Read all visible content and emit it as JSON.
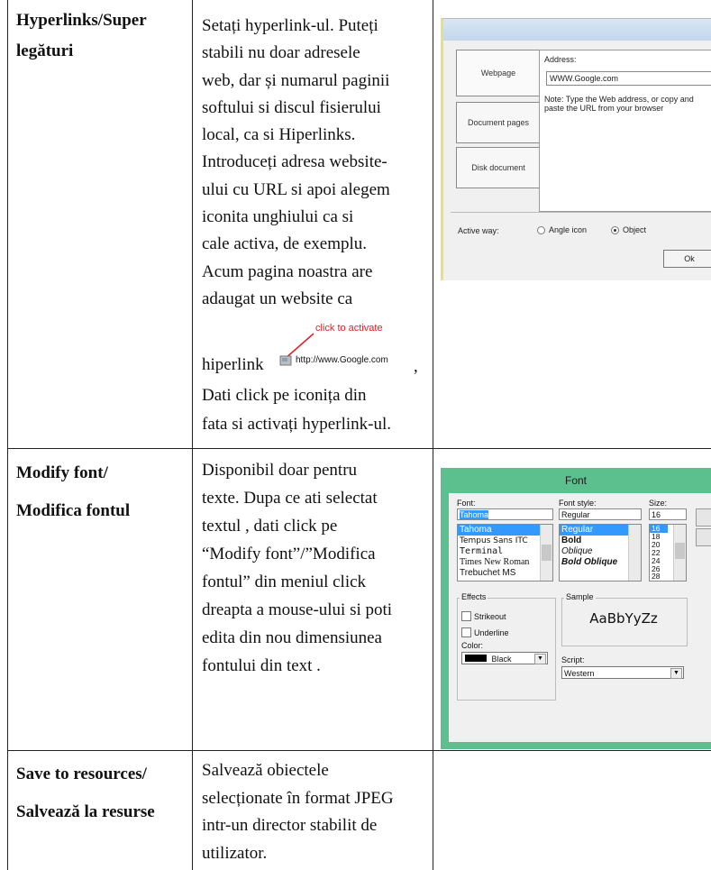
{
  "rows": [
    {
      "label_lines": [
        "Hyperlinks/Super",
        "legături"
      ],
      "desc_lines": [
        "Setați hyperlink-ul. Puteți",
        "stabili nu doar adresele",
        "web, dar și numarul paginii",
        "softului si discul fisierului",
        "local, ca si Hiperlinks.",
        "Introduceți adresa website-",
        "ului cu URL si apoi alegem",
        "iconita unghiului ca si",
        "cale activa, de exemplu.",
        "Acum pagina noastra are",
        "adaugat un website ca"
      ],
      "hyperlink_word": "hiperlink",
      "click_annotation": "click to activate",
      "link_url": "http://www.Google.com",
      "comma": ",",
      "desc_tail": [
        "Dati click pe iconița din",
        "fata si activați hyperlink-ul."
      ]
    },
    {
      "label_lines": [
        "Modify font/",
        "Modifica fontul"
      ],
      "desc_lines": [
        "Disponibil doar pentru",
        "texte. Dupa ce ati selectat",
        "textul , dati click pe",
        "“Modify font”/”Modifica",
        "fontul” din meniul click",
        "dreapta a mouse-ului si poti",
        "edita din nou dimensiunea",
        "fontului din text ."
      ]
    },
    {
      "label_lines": [
        "Save to resources/",
        "Salvează la resurse"
      ],
      "desc_lines": [
        "Salvează obiectele",
        "selecționate în format JPEG",
        "intr-un director stabilit de",
        "utilizator."
      ]
    }
  ],
  "hyperlink_dialog": {
    "tabs": [
      "Webpage",
      "Document pages",
      "Disk document"
    ],
    "address_label": "Address:",
    "address_value": "WWW.Google.com",
    "note": "Note: Type the Web address, or copy and paste the URL from your browser",
    "active_way_label": "Active way:",
    "radio_angle": "Angle icon",
    "radio_object": "Object",
    "selected_radio": "Object",
    "ok_label": "Ok"
  },
  "font_dialog": {
    "title": "Font",
    "font_label": "Font:",
    "font_value": "Tahoma",
    "font_list": [
      "Tahoma",
      "Tempus Sans ITC",
      "Terminal",
      "Times New Roman",
      "Trebuchet MS"
    ],
    "style_label": "Font style:",
    "style_value": "Regular",
    "style_list": [
      "Regular",
      "Bold",
      "Oblique",
      "Bold Oblique"
    ],
    "size_label": "Size:",
    "size_value": "16",
    "size_list": [
      "16",
      "18",
      "20",
      "22",
      "24",
      "26",
      "28"
    ],
    "effects_label": "Effects",
    "strikeout_label": "Strikeout",
    "underline_label": "Underline",
    "color_label": "Color:",
    "color_value": "Black",
    "sample_label": "Sample",
    "sample_text": "AaBbYyZz",
    "script_label": "Script:",
    "script_value": "Western",
    "accent_color": "#5cbf8e",
    "selection_color": "#3399ff"
  }
}
